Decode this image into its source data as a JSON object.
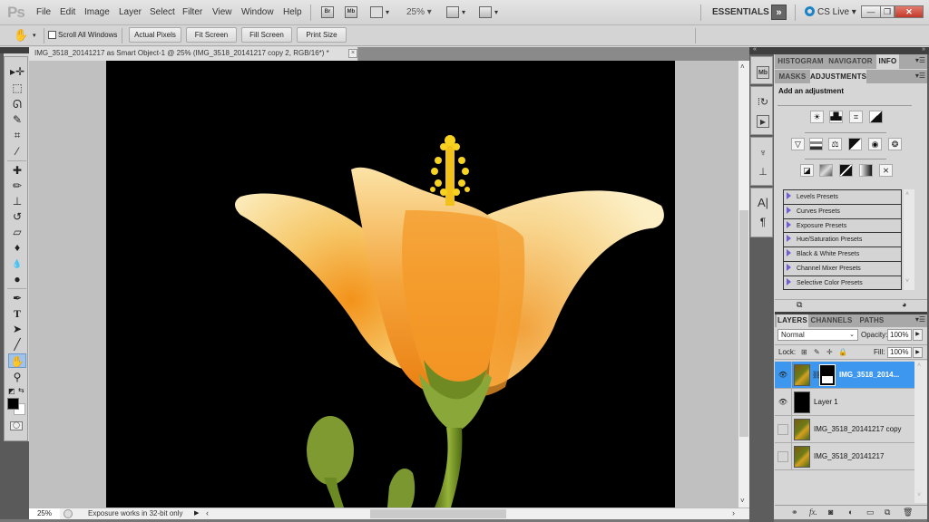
{
  "app": {
    "logo": "Ps",
    "menu": [
      "File",
      "Edit",
      "Image",
      "Layer",
      "Select",
      "Filter",
      "View",
      "Window",
      "Help"
    ],
    "bridge_label": "Br",
    "minibridge_label": "Mb",
    "zoom_level": "25%",
    "workspace": "ESSENTIALS",
    "more_workspaces": "»",
    "cs_live": "CS Live ▾",
    "window_controls": {
      "minimize": "—",
      "restore": "❐",
      "close": "✕"
    }
  },
  "options_bar": {
    "tool_icon": "hand-icon",
    "scroll_all_windows_label": "Scroll All Windows",
    "scroll_all_windows_checked": false,
    "buttons": [
      "Actual Pixels",
      "Fit Screen",
      "Fill Screen",
      "Print Size"
    ]
  },
  "document": {
    "tab_title": "IMG_3518_20141217 as Smart Object-1 @ 25% (IMG_3518_20141217 copy 2, RGB/16*) *",
    "close": "×"
  },
  "tools": [
    {
      "name": "move-tool",
      "glyph": "▸✛"
    },
    {
      "name": "marquee-tool",
      "glyph": "⬚"
    },
    {
      "name": "lasso-tool",
      "glyph": "ᘏ"
    },
    {
      "name": "quick-selection-tool",
      "glyph": "✎"
    },
    {
      "name": "crop-tool",
      "glyph": "⌗"
    },
    {
      "name": "eyedropper-tool",
      "glyph": "⁄"
    },
    {
      "name": "healing-brush-tool",
      "glyph": "✚"
    },
    {
      "name": "brush-tool",
      "glyph": "✏"
    },
    {
      "name": "clone-stamp-tool",
      "glyph": "⊥"
    },
    {
      "name": "history-brush-tool",
      "glyph": "↺"
    },
    {
      "name": "eraser-tool",
      "glyph": "▱"
    },
    {
      "name": "paint-bucket-tool",
      "glyph": "♦"
    },
    {
      "name": "blur-tool",
      "glyph": "💧"
    },
    {
      "name": "dodge-tool",
      "glyph": "●"
    },
    {
      "name": "pen-tool",
      "glyph": "✒"
    },
    {
      "name": "type-tool",
      "glyph": "T"
    },
    {
      "name": "path-selection-tool",
      "glyph": "➤"
    },
    {
      "name": "line-tool",
      "glyph": "╱"
    },
    {
      "name": "hand-tool",
      "glyph": "✋",
      "active": true
    },
    {
      "name": "zoom-tool",
      "glyph": "⚲"
    }
  ],
  "colors": {
    "foreground": "#000000",
    "background": "#ffffff",
    "accent": "#3d97ef"
  },
  "status": {
    "zoom": "25%",
    "message": "Exposure works in 32-bit only"
  },
  "panels": {
    "top_tabs": [
      "HISTOGRAM",
      "NAVIGATOR",
      "INFO"
    ],
    "top_active": "INFO",
    "adj_tabs": [
      "MASKS",
      "ADJUSTMENTS"
    ],
    "adj_active": "ADJUSTMENTS",
    "adj_title": "Add an adjustment",
    "adj_icons_row1": [
      "brightness-contrast",
      "levels",
      "curves",
      "exposure"
    ],
    "adj_icons_row2": [
      "vibrance",
      "hue-saturation",
      "color-balance",
      "black-white",
      "photo-filter",
      "channel-mixer"
    ],
    "adj_icons_row3": [
      "invert",
      "posterize",
      "threshold",
      "gradient-map",
      "selective-color"
    ],
    "presets": [
      "Levels Presets",
      "Curves Presets",
      "Exposure Presets",
      "Hue/Saturation Presets",
      "Black & White Presets",
      "Channel Mixer Presets",
      "Selective Color Presets"
    ]
  },
  "layers": {
    "tabs": [
      "LAYERS",
      "CHANNELS",
      "PATHS"
    ],
    "active_tab": "LAYERS",
    "blend_mode": "Normal",
    "opacity_label": "Opacity:",
    "opacity": "100%",
    "lock_label": "Lock:",
    "fill_label": "Fill:",
    "fill": "100%",
    "items": [
      {
        "name": "IMG_3518_2014...",
        "visible": true,
        "selected": true,
        "has_mask": true,
        "thumb": "photo"
      },
      {
        "name": "Layer 1",
        "visible": true,
        "selected": false,
        "has_mask": false,
        "thumb": "black"
      },
      {
        "name": "IMG_3518_20141217 copy",
        "visible": false,
        "selected": false,
        "has_mask": false,
        "thumb": "photo"
      },
      {
        "name": "IMG_3518_20141217",
        "visible": false,
        "selected": false,
        "has_mask": false,
        "thumb": "photo"
      }
    ],
    "footer_icons": [
      "link-layers",
      "fx",
      "add-mask",
      "new-adjustment",
      "new-group",
      "new-layer",
      "delete-layer"
    ]
  }
}
